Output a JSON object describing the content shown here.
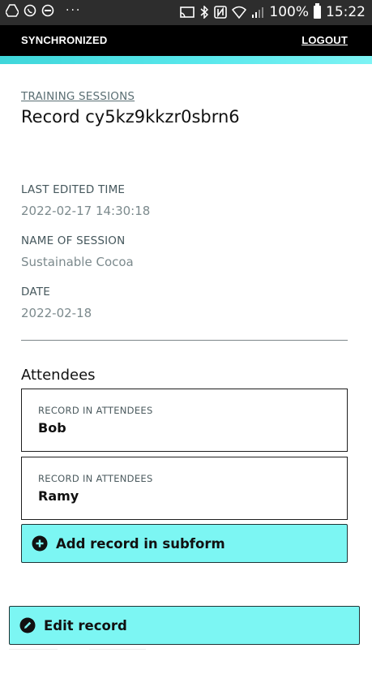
{
  "status_bar": {
    "battery": "100%",
    "time": "15:22",
    "overflow": "···"
  },
  "header": {
    "sync_status": "SYNCHRONIZED",
    "logout_label": "LOGOUT"
  },
  "breadcrumb": "TRAINING SESSIONS",
  "record_title": "Record cy5kz9kkzr0sbrn6",
  "fields": [
    {
      "label": "LAST EDITED TIME",
      "value": "2022-02-17 14:30:18"
    },
    {
      "label": "NAME OF SESSION",
      "value": "Sustainable Cocoa"
    },
    {
      "label": "DATE",
      "value": "2022-02-18"
    }
  ],
  "attendees": {
    "title": "Attendees",
    "records": [
      {
        "label": "RECORD IN ATTENDEES",
        "value": "Bob"
      },
      {
        "label": "RECORD IN ATTENDEES",
        "value": "Ramy"
      }
    ],
    "add_label": "Add record in subform"
  },
  "edit_label": "Edit record",
  "colors": {
    "accent": "#7cf6f3",
    "header_bg": "#000000",
    "status_bar_bg": "#2d2d2d"
  },
  "icons": [
    "plus-circle-icon",
    "pencil-circle-icon",
    "cast-icon",
    "bluetooth-icon",
    "nfc-icon",
    "wifi-icon",
    "signal-icon",
    "battery-icon"
  ]
}
